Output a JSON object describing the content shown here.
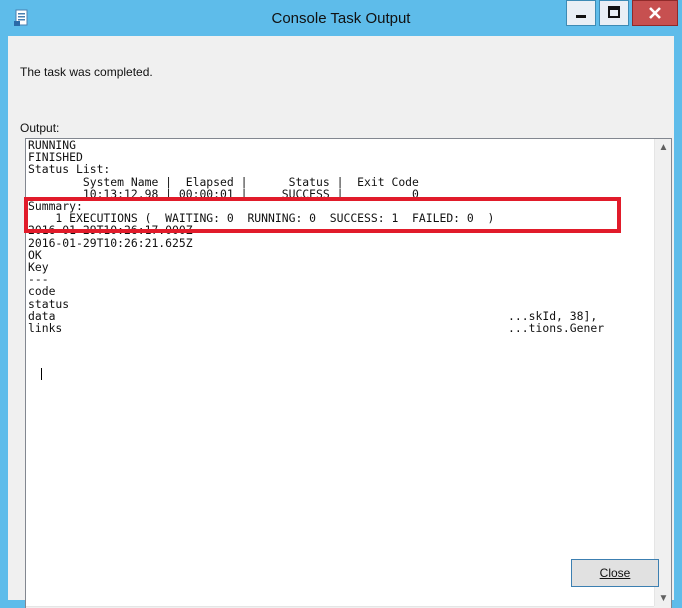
{
  "window": {
    "title": "Console Task Output",
    "minimize_label": "Minimize",
    "maximize_label": "Maximize",
    "close_label": "Close window"
  },
  "message": "The task was completed.",
  "output": {
    "label": "Output:",
    "text": "RUNNING\nFINISHED\nStatus List:\n        System Name |  Elapsed |      Status |  Exit Code\n        10:13:12.98 | 00:00:01 |     SUCCESS |          0\nSummary:\n    1 EXECUTIONS (  WAITING: 0  RUNNING: 0  SUCCESS: 1  FAILED: 0  )\n2016-01-29T10:26:17.000Z\n2016-01-29T10:26:21.625Z\nOK\nKey\n---\ncode\nstatus\ndata                                                                  ...skId, 38],\nlinks                                                                 ...tions.Gener"
  },
  "buttons": {
    "close": "Close"
  },
  "icons": {
    "app": "console-window-icon",
    "up": "scroll-up-icon",
    "down": "scroll-down-icon",
    "left": "scroll-left-icon",
    "right": "scroll-right-icon"
  },
  "colors": {
    "titlebar": "#5ebcea",
    "close_button": "#c75050",
    "highlight": "#e11b2a"
  }
}
